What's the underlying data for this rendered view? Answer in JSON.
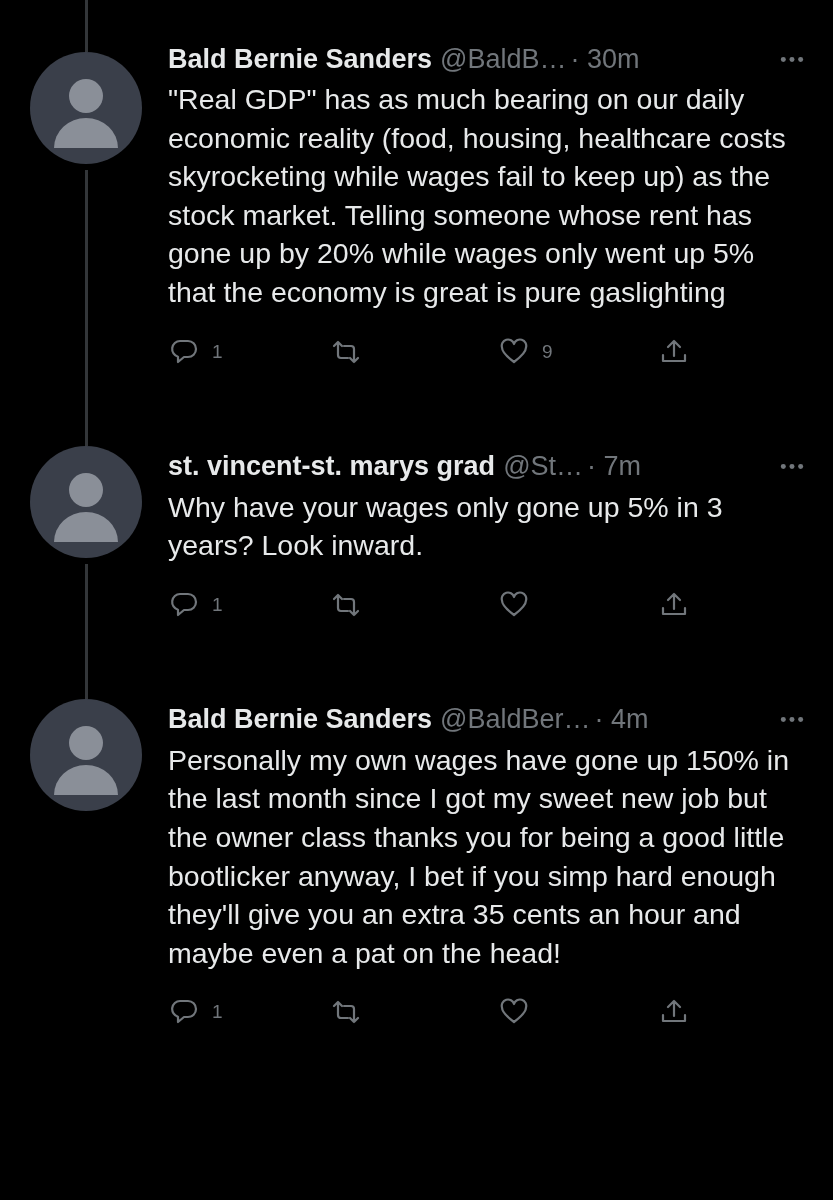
{
  "tweets": [
    {
      "name": "Bald Bernie Sanders",
      "handle": "@BaldB…",
      "time": "· 30m",
      "text": "\"Real GDP\" has as much bearing on our daily economic reality (food, housing, healthcare costs skyrocketing while wages fail to keep up) as the stock market. Telling someone whose rent has gone up by 20% while wages only went up 5% that the economy is great is pure gaslighting",
      "actions": [
        {
          "kind": "reply",
          "count": "1"
        },
        {
          "kind": "retweet"
        },
        {
          "kind": "like",
          "count": "9"
        },
        {
          "kind": "share"
        }
      ]
    },
    {
      "name": "st. vincent-st. marys grad",
      "handle": "@St…",
      "time": "· 7m",
      "text": "Why have your wages only gone up 5% in 3 years? Look inward.",
      "actions": [
        {
          "kind": "reply",
          "count": "1"
        },
        {
          "kind": "retweet"
        },
        {
          "kind": "like"
        },
        {
          "kind": "share"
        }
      ]
    },
    {
      "name": "Bald Bernie Sanders",
      "handle": "@BaldBer…",
      "time": "· 4m",
      "text": "Personally my own wages have gone up 150% in the last month since I got my sweet new job but the owner class thanks you for being a good little bootlicker anyway, I bet if you simp hard enough they'll give you an extra 35 cents an hour and maybe even a pat on the head!",
      "actions": [
        {
          "kind": "reply",
          "count": "1"
        },
        {
          "kind": "retweet"
        },
        {
          "kind": "like"
        },
        {
          "kind": "share"
        }
      ]
    }
  ]
}
